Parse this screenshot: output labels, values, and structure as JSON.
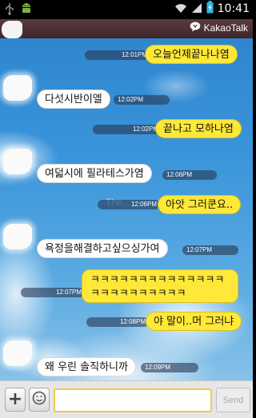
{
  "status_bar": {
    "time": "10:41",
    "icons": [
      "usb-icon",
      "android-icon",
      "wifi-icon",
      "signal-icon",
      "battery-icon"
    ]
  },
  "header": {
    "app_name": "KakaoTalk",
    "brand_icon": "kakao-talk-icon"
  },
  "watermark": "The…",
  "messages": [
    {
      "side": "mine",
      "text": "오늘언제끝나나염",
      "time": "12:01PM"
    },
    {
      "side": "theirs",
      "text": "다섯시반이엘",
      "time": "12:02PM"
    },
    {
      "side": "mine",
      "text": "끝나고 모하나염",
      "time": "12:02PM"
    },
    {
      "side": "theirs",
      "text": "여덟시에 필라테스가염",
      "time": "12:06PM"
    },
    {
      "side": "mine",
      "text": "아앗 그러쿤요..",
      "time": "12:06PM"
    },
    {
      "side": "theirs",
      "text": "욕정을해결하고싶으싱가여",
      "time": "12:07PM"
    },
    {
      "side": "mine",
      "text": "ㅋㅋㅋㅋㅋㅋㅋㅋㅋㅋㅋㅋㅋㅋㅋㅋㅋㅋㅋㅋㅋㅋㅋㅋ",
      "time": "12:07PM"
    },
    {
      "side": "mine",
      "text": "야 말이..머 그러냐",
      "time": "12:08PM"
    },
    {
      "side": "theirs",
      "text": "왜 우린 솔직하니까",
      "time": "12:09PM"
    }
  ],
  "input_bar": {
    "add_label": "+",
    "emoticon_icon": "smiley-icon",
    "input_value": "",
    "input_placeholder": "",
    "send_label": "Send"
  },
  "colors": {
    "my_bubble": "#ffe838",
    "their_bubble": "#ffffff",
    "header": "#4a2f33"
  }
}
